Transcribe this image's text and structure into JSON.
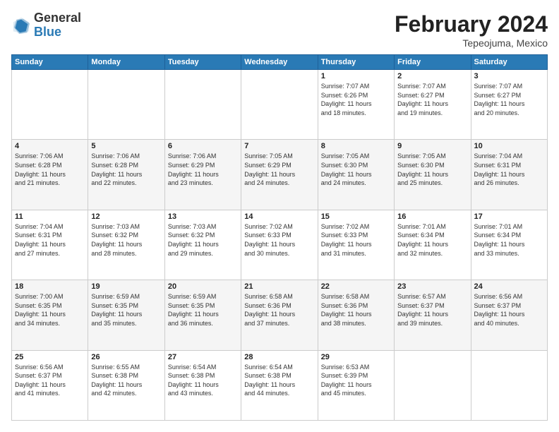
{
  "header": {
    "logo_general": "General",
    "logo_blue": "Blue",
    "month_title": "February 2024",
    "location": "Tepeojuma, Mexico"
  },
  "days_of_week": [
    "Sunday",
    "Monday",
    "Tuesday",
    "Wednesday",
    "Thursday",
    "Friday",
    "Saturday"
  ],
  "weeks": [
    [
      {
        "day": "",
        "info": ""
      },
      {
        "day": "",
        "info": ""
      },
      {
        "day": "",
        "info": ""
      },
      {
        "day": "",
        "info": ""
      },
      {
        "day": "1",
        "info": "Sunrise: 7:07 AM\nSunset: 6:26 PM\nDaylight: 11 hours\nand 18 minutes."
      },
      {
        "day": "2",
        "info": "Sunrise: 7:07 AM\nSunset: 6:27 PM\nDaylight: 11 hours\nand 19 minutes."
      },
      {
        "day": "3",
        "info": "Sunrise: 7:07 AM\nSunset: 6:27 PM\nDaylight: 11 hours\nand 20 minutes."
      }
    ],
    [
      {
        "day": "4",
        "info": "Sunrise: 7:06 AM\nSunset: 6:28 PM\nDaylight: 11 hours\nand 21 minutes."
      },
      {
        "day": "5",
        "info": "Sunrise: 7:06 AM\nSunset: 6:28 PM\nDaylight: 11 hours\nand 22 minutes."
      },
      {
        "day": "6",
        "info": "Sunrise: 7:06 AM\nSunset: 6:29 PM\nDaylight: 11 hours\nand 23 minutes."
      },
      {
        "day": "7",
        "info": "Sunrise: 7:05 AM\nSunset: 6:29 PM\nDaylight: 11 hours\nand 24 minutes."
      },
      {
        "day": "8",
        "info": "Sunrise: 7:05 AM\nSunset: 6:30 PM\nDaylight: 11 hours\nand 24 minutes."
      },
      {
        "day": "9",
        "info": "Sunrise: 7:05 AM\nSunset: 6:30 PM\nDaylight: 11 hours\nand 25 minutes."
      },
      {
        "day": "10",
        "info": "Sunrise: 7:04 AM\nSunset: 6:31 PM\nDaylight: 11 hours\nand 26 minutes."
      }
    ],
    [
      {
        "day": "11",
        "info": "Sunrise: 7:04 AM\nSunset: 6:31 PM\nDaylight: 11 hours\nand 27 minutes."
      },
      {
        "day": "12",
        "info": "Sunrise: 7:03 AM\nSunset: 6:32 PM\nDaylight: 11 hours\nand 28 minutes."
      },
      {
        "day": "13",
        "info": "Sunrise: 7:03 AM\nSunset: 6:32 PM\nDaylight: 11 hours\nand 29 minutes."
      },
      {
        "day": "14",
        "info": "Sunrise: 7:02 AM\nSunset: 6:33 PM\nDaylight: 11 hours\nand 30 minutes."
      },
      {
        "day": "15",
        "info": "Sunrise: 7:02 AM\nSunset: 6:33 PM\nDaylight: 11 hours\nand 31 minutes."
      },
      {
        "day": "16",
        "info": "Sunrise: 7:01 AM\nSunset: 6:34 PM\nDaylight: 11 hours\nand 32 minutes."
      },
      {
        "day": "17",
        "info": "Sunrise: 7:01 AM\nSunset: 6:34 PM\nDaylight: 11 hours\nand 33 minutes."
      }
    ],
    [
      {
        "day": "18",
        "info": "Sunrise: 7:00 AM\nSunset: 6:35 PM\nDaylight: 11 hours\nand 34 minutes."
      },
      {
        "day": "19",
        "info": "Sunrise: 6:59 AM\nSunset: 6:35 PM\nDaylight: 11 hours\nand 35 minutes."
      },
      {
        "day": "20",
        "info": "Sunrise: 6:59 AM\nSunset: 6:35 PM\nDaylight: 11 hours\nand 36 minutes."
      },
      {
        "day": "21",
        "info": "Sunrise: 6:58 AM\nSunset: 6:36 PM\nDaylight: 11 hours\nand 37 minutes."
      },
      {
        "day": "22",
        "info": "Sunrise: 6:58 AM\nSunset: 6:36 PM\nDaylight: 11 hours\nand 38 minutes."
      },
      {
        "day": "23",
        "info": "Sunrise: 6:57 AM\nSunset: 6:37 PM\nDaylight: 11 hours\nand 39 minutes."
      },
      {
        "day": "24",
        "info": "Sunrise: 6:56 AM\nSunset: 6:37 PM\nDaylight: 11 hours\nand 40 minutes."
      }
    ],
    [
      {
        "day": "25",
        "info": "Sunrise: 6:56 AM\nSunset: 6:37 PM\nDaylight: 11 hours\nand 41 minutes."
      },
      {
        "day": "26",
        "info": "Sunrise: 6:55 AM\nSunset: 6:38 PM\nDaylight: 11 hours\nand 42 minutes."
      },
      {
        "day": "27",
        "info": "Sunrise: 6:54 AM\nSunset: 6:38 PM\nDaylight: 11 hours\nand 43 minutes."
      },
      {
        "day": "28",
        "info": "Sunrise: 6:54 AM\nSunset: 6:38 PM\nDaylight: 11 hours\nand 44 minutes."
      },
      {
        "day": "29",
        "info": "Sunrise: 6:53 AM\nSunset: 6:39 PM\nDaylight: 11 hours\nand 45 minutes."
      },
      {
        "day": "",
        "info": ""
      },
      {
        "day": "",
        "info": ""
      }
    ]
  ]
}
